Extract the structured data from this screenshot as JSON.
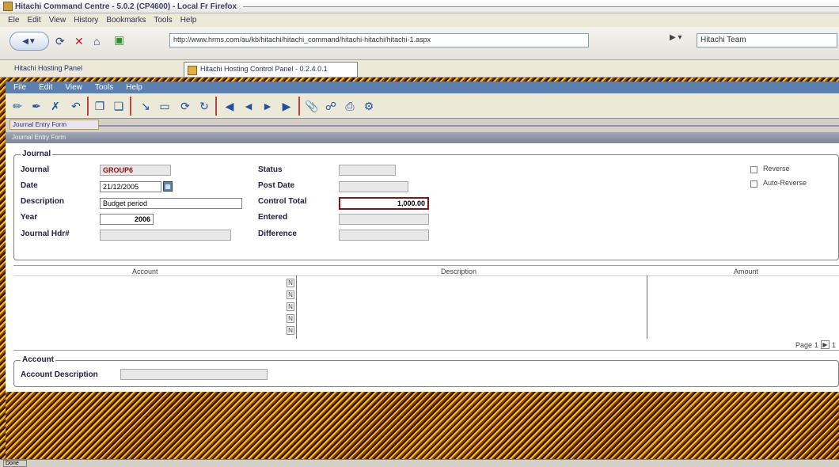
{
  "browser": {
    "title": "Hitachi Command Centre - 5.0.2 (CP4600) - Local Fr Firefox",
    "menu": [
      "Ele",
      "Edit",
      "View",
      "History",
      "Bookmarks",
      "Tools",
      "Help"
    ],
    "back_label": "",
    "url": "http://www.hrms.com/au/kb/hitachi/hitachi_command/hitachi-hitachi/hitachi-1.aspx",
    "search_placeholder": "Hitachi Team",
    "bookmark_link": "Hitachi Hosting Panel",
    "tab_label": "Hitachi Hosting Control Panel - 0.2.4.0.1"
  },
  "app": {
    "menu": [
      "File",
      "Edit",
      "View",
      "Tools",
      "Help"
    ],
    "breadcrumb": "Journal  Entry  Form",
    "window_title": "Journal Entry Form"
  },
  "journal": {
    "legend": "Journal",
    "labels": {
      "journal": "Journal",
      "date": "Date",
      "description": "Description",
      "year": "Year",
      "journal_hash": "Journal Hdr#",
      "status": "Status",
      "post_date": "Post Date",
      "control_total": "Control Total",
      "entered": "Entered",
      "difference": "Difference"
    },
    "values": {
      "journal": "GROUP6",
      "date": "21/12/2005",
      "description": "Budget period",
      "year": "2006",
      "journal_hash": "",
      "status": "",
      "post_date": "",
      "control_total": "1,000.00",
      "entered": "",
      "difference": ""
    },
    "checkboxes": [
      "Reverse",
      "Auto-Reverse"
    ]
  },
  "lines": {
    "columns": [
      "Account",
      "Description",
      "Amount"
    ],
    "row_markers": [
      "N",
      "N",
      "N",
      "N",
      "N"
    ],
    "pagination_label": "Page",
    "pagination_value": "1",
    "pagination_of": "1"
  },
  "account": {
    "legend": "Account",
    "description_label": "Account Description",
    "description_value": ""
  },
  "status_bar": {
    "label": "Done"
  }
}
